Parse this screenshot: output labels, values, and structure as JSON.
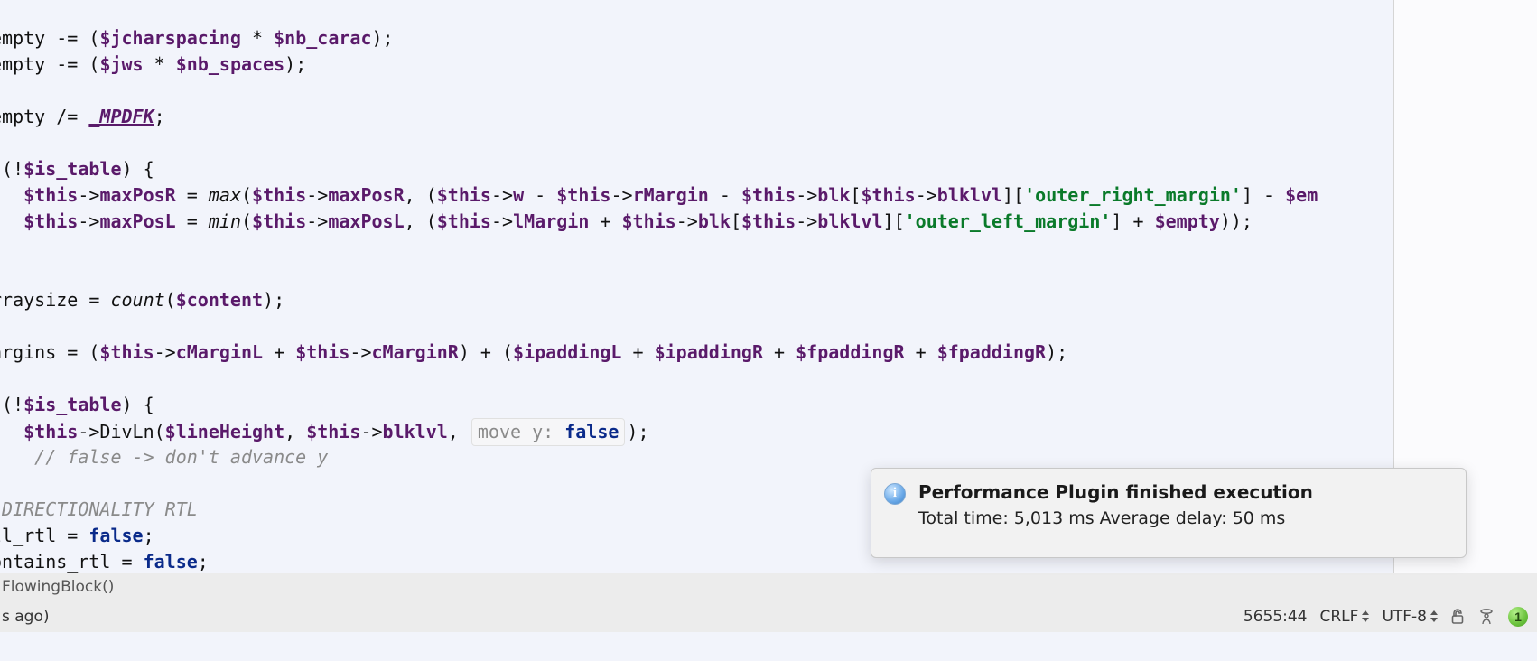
{
  "code": {
    "lines": [
      {
        "type": "expr",
        "parts": [
          {
            "txt": "empty",
            "cls": "tok-punc"
          },
          {
            "txt": " -= (",
            "cls": "tok-punc"
          },
          {
            "txt": "$jcharspacing",
            "cls": "tok-var"
          },
          {
            "txt": " * ",
            "cls": "tok-punc"
          },
          {
            "txt": "$nb_carac",
            "cls": "tok-var"
          },
          {
            "txt": ");",
            "cls": "tok-punc"
          }
        ]
      },
      {
        "type": "expr",
        "parts": [
          {
            "txt": "empty",
            "cls": "tok-punc"
          },
          {
            "txt": " -= (",
            "cls": "tok-punc"
          },
          {
            "txt": "$jws",
            "cls": "tok-var"
          },
          {
            "txt": " * ",
            "cls": "tok-punc"
          },
          {
            "txt": "$nb_spaces",
            "cls": "tok-var"
          },
          {
            "txt": ");",
            "cls": "tok-punc"
          }
        ]
      },
      {
        "type": "blank"
      },
      {
        "type": "expr",
        "parts": [
          {
            "txt": "empty",
            "cls": "tok-punc"
          },
          {
            "txt": " /= ",
            "cls": "tok-punc"
          },
          {
            "txt": "_MPDFK",
            "cls": "tok-const"
          },
          {
            "txt": ";",
            "cls": "tok-punc"
          }
        ]
      },
      {
        "type": "blank"
      },
      {
        "type": "expr",
        "parts": [
          {
            "txt": " (!",
            "cls": "tok-punc"
          },
          {
            "txt": "$is_table",
            "cls": "tok-var"
          },
          {
            "txt": ") {",
            "cls": "tok-punc"
          }
        ]
      },
      {
        "type": "expr",
        "indent": "   ",
        "parts": [
          {
            "txt": "$this",
            "cls": "tok-var"
          },
          {
            "txt": "->",
            "cls": "tok-arrow"
          },
          {
            "txt": "maxPosR",
            "cls": "tok-prop"
          },
          {
            "txt": " = ",
            "cls": "tok-punc"
          },
          {
            "txt": "max",
            "cls": "tok-funcit"
          },
          {
            "txt": "(",
            "cls": "tok-punc"
          },
          {
            "txt": "$this",
            "cls": "tok-var"
          },
          {
            "txt": "->",
            "cls": "tok-arrow"
          },
          {
            "txt": "maxPosR",
            "cls": "tok-prop"
          },
          {
            "txt": ", (",
            "cls": "tok-punc"
          },
          {
            "txt": "$this",
            "cls": "tok-var"
          },
          {
            "txt": "->",
            "cls": "tok-arrow"
          },
          {
            "txt": "w",
            "cls": "tok-prop"
          },
          {
            "txt": " - ",
            "cls": "tok-punc"
          },
          {
            "txt": "$this",
            "cls": "tok-var"
          },
          {
            "txt": "->",
            "cls": "tok-arrow"
          },
          {
            "txt": "rMargin",
            "cls": "tok-prop"
          },
          {
            "txt": " - ",
            "cls": "tok-punc"
          },
          {
            "txt": "$this",
            "cls": "tok-var"
          },
          {
            "txt": "->",
            "cls": "tok-arrow"
          },
          {
            "txt": "blk",
            "cls": "tok-prop"
          },
          {
            "txt": "[",
            "cls": "tok-punc"
          },
          {
            "txt": "$this",
            "cls": "tok-var"
          },
          {
            "txt": "->",
            "cls": "tok-arrow"
          },
          {
            "txt": "blklvl",
            "cls": "tok-prop"
          },
          {
            "txt": "][",
            "cls": "tok-punc"
          },
          {
            "txt": "'outer_right_margin'",
            "cls": "tok-str"
          },
          {
            "txt": "] - ",
            "cls": "tok-punc"
          },
          {
            "txt": "$em",
            "cls": "tok-var"
          }
        ]
      },
      {
        "type": "expr",
        "indent": "   ",
        "parts": [
          {
            "txt": "$this",
            "cls": "tok-var"
          },
          {
            "txt": "->",
            "cls": "tok-arrow"
          },
          {
            "txt": "maxPosL",
            "cls": "tok-prop"
          },
          {
            "txt": " = ",
            "cls": "tok-punc"
          },
          {
            "txt": "min",
            "cls": "tok-funcit"
          },
          {
            "txt": "(",
            "cls": "tok-punc"
          },
          {
            "txt": "$this",
            "cls": "tok-var"
          },
          {
            "txt": "->",
            "cls": "tok-arrow"
          },
          {
            "txt": "maxPosL",
            "cls": "tok-prop"
          },
          {
            "txt": ", (",
            "cls": "tok-punc"
          },
          {
            "txt": "$this",
            "cls": "tok-var"
          },
          {
            "txt": "->",
            "cls": "tok-arrow"
          },
          {
            "txt": "lMargin",
            "cls": "tok-prop"
          },
          {
            "txt": " + ",
            "cls": "tok-punc"
          },
          {
            "txt": "$this",
            "cls": "tok-var"
          },
          {
            "txt": "->",
            "cls": "tok-arrow"
          },
          {
            "txt": "blk",
            "cls": "tok-prop"
          },
          {
            "txt": "[",
            "cls": "tok-punc"
          },
          {
            "txt": "$this",
            "cls": "tok-var"
          },
          {
            "txt": "->",
            "cls": "tok-arrow"
          },
          {
            "txt": "blklvl",
            "cls": "tok-prop"
          },
          {
            "txt": "][",
            "cls": "tok-punc"
          },
          {
            "txt": "'outer_left_margin'",
            "cls": "tok-str"
          },
          {
            "txt": "] + ",
            "cls": "tok-punc"
          },
          {
            "txt": "$empty",
            "cls": "tok-var"
          },
          {
            "txt": "));",
            "cls": "tok-punc"
          }
        ]
      },
      {
        "type": "blank"
      },
      {
        "type": "blank"
      },
      {
        "type": "expr",
        "parts": [
          {
            "txt": "rraysize",
            "cls": "tok-punc"
          },
          {
            "txt": " = ",
            "cls": "tok-punc"
          },
          {
            "txt": "count",
            "cls": "tok-funcit"
          },
          {
            "txt": "(",
            "cls": "tok-punc"
          },
          {
            "txt": "$content",
            "cls": "tok-var"
          },
          {
            "txt": ");",
            "cls": "tok-punc"
          }
        ]
      },
      {
        "type": "blank"
      },
      {
        "type": "expr",
        "parts": [
          {
            "txt": "argins",
            "cls": "tok-punc"
          },
          {
            "txt": " = (",
            "cls": "tok-punc"
          },
          {
            "txt": "$this",
            "cls": "tok-var"
          },
          {
            "txt": "->",
            "cls": "tok-arrow"
          },
          {
            "txt": "cMarginL",
            "cls": "tok-prop"
          },
          {
            "txt": " + ",
            "cls": "tok-punc"
          },
          {
            "txt": "$this",
            "cls": "tok-var"
          },
          {
            "txt": "->",
            "cls": "tok-arrow"
          },
          {
            "txt": "cMarginR",
            "cls": "tok-prop"
          },
          {
            "txt": ") + (",
            "cls": "tok-punc"
          },
          {
            "txt": "$ipaddingL",
            "cls": "tok-var"
          },
          {
            "txt": " + ",
            "cls": "tok-punc"
          },
          {
            "txt": "$ipaddingR",
            "cls": "tok-var"
          },
          {
            "txt": " + ",
            "cls": "tok-punc"
          },
          {
            "txt": "$fpaddingR",
            "cls": "tok-var"
          },
          {
            "txt": " + ",
            "cls": "tok-punc"
          },
          {
            "txt": "$fpaddingR",
            "cls": "tok-var"
          },
          {
            "txt": ");",
            "cls": "tok-punc"
          }
        ]
      },
      {
        "type": "blank"
      },
      {
        "type": "expr",
        "parts": [
          {
            "txt": " (!",
            "cls": "tok-punc"
          },
          {
            "txt": "$is_table",
            "cls": "tok-var"
          },
          {
            "txt": ") {",
            "cls": "tok-punc"
          }
        ]
      },
      {
        "type": "hinted",
        "indent": "   ",
        "parts_before": [
          {
            "txt": "$this",
            "cls": "tok-var"
          },
          {
            "txt": "->DivLn(",
            "cls": "tok-punc"
          },
          {
            "txt": "$lineHeight",
            "cls": "tok-var"
          },
          {
            "txt": ", ",
            "cls": "tok-punc"
          },
          {
            "txt": "$this",
            "cls": "tok-var"
          },
          {
            "txt": "->",
            "cls": "tok-arrow"
          },
          {
            "txt": "blklvl",
            "cls": "tok-prop"
          },
          {
            "txt": ", ",
            "cls": "tok-punc"
          }
        ],
        "hint_key": "move_y:",
        "hint_val": "false",
        "parts_after": [
          {
            "txt": ");",
            "cls": "tok-punc"
          }
        ]
      },
      {
        "type": "expr",
        "indent": "    ",
        "parts": [
          {
            "txt": "// false -> don't advance y",
            "cls": "tok-comment"
          }
        ]
      },
      {
        "type": "blank"
      },
      {
        "type": "expr",
        "parts": [
          {
            "txt": " DIRECTIONALITY RTL",
            "cls": "tok-comment"
          }
        ]
      },
      {
        "type": "expr",
        "parts": [
          {
            "txt": "ll_rtl",
            "cls": "tok-punc"
          },
          {
            "txt": " = ",
            "cls": "tok-punc"
          },
          {
            "txt": "false",
            "cls": "tok-kw"
          },
          {
            "txt": ";",
            "cls": "tok-punc"
          }
        ]
      },
      {
        "type": "expr",
        "parts": [
          {
            "txt": "ontains_rtl",
            "cls": "tok-punc"
          },
          {
            "txt": " = ",
            "cls": "tok-punc"
          },
          {
            "txt": "false",
            "cls": "tok-kw"
          },
          {
            "txt": ";",
            "cls": "tok-punc"
          }
        ]
      }
    ]
  },
  "notification": {
    "title": "Performance Plugin finished execution",
    "message": "Total time: 5,013 ms Average delay: 50 ms",
    "icon_glyph": "i"
  },
  "breadcrumb": {
    "text": "FlowingBlock()"
  },
  "status": {
    "left": "s ago)",
    "cursor": "5655:44",
    "line_sep": "CRLF",
    "encoding": "UTF-8",
    "indicator_count": "1"
  }
}
